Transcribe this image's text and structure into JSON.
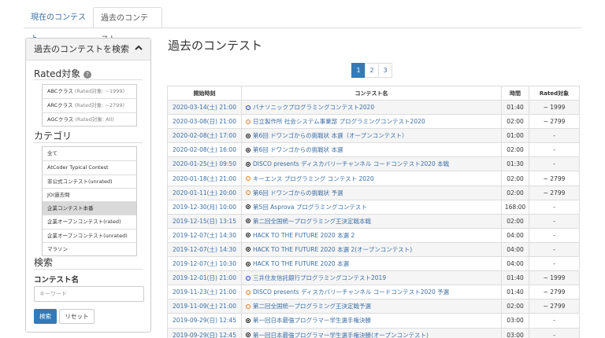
{
  "tabs": [
    "現在のコンテスト",
    "過去のコンテスト"
  ],
  "sidebar": {
    "header": "過去のコンテストを検索",
    "rated_title": "Rated対象",
    "rated_items": [
      {
        "label": "ABCクラス",
        "sub": "(Rated対象: ~1999)"
      },
      {
        "label": "ARCクラス",
        "sub": "(Rated対象: ~2799)"
      },
      {
        "label": "AGCクラス",
        "sub": "(Rated対象: All)"
      }
    ],
    "category_title": "カテゴリ",
    "category_items": [
      "全て",
      "AtCoder Typical Contest",
      "非公式コンテスト(unrated)",
      "JOI過去問",
      "企業コンテスト本番",
      "企業オープンコンテスト(rated)",
      "企業オープンコンテスト(unrated)",
      "マラソン"
    ],
    "category_selected": 4,
    "search_title": "検索",
    "contest_name_label": "コンテスト名",
    "keyword_placeholder": "キーワード",
    "search_button": "検索",
    "reset_button": "リセット"
  },
  "main": {
    "title": "過去のコンテスト",
    "pages": [
      "1",
      "2",
      "3"
    ],
    "active_page": 0,
    "columns": [
      "開始時刻",
      "コンテスト名",
      "時間",
      "Rated対象"
    ],
    "rows": [
      {
        "start": "2020-03-14(土) 21:00",
        "icon": "blue",
        "name": "パナソニックプログラミングコンテスト2020",
        "duration": "01:40",
        "rated": "~ 1999"
      },
      {
        "start": "2020-03-08(日) 21:00",
        "icon": "orange",
        "name": "日立製作所 社会システム事業部 プログラミングコンテスト2020",
        "duration": "02:00",
        "rated": "~ 2799"
      },
      {
        "start": "2020-02-08(土) 17:00",
        "icon": "black",
        "name": "第6回 ドワンゴからの挑戦状 本選（オープンコンテスト）",
        "duration": "01:00",
        "rated": "-"
      },
      {
        "start": "2020-02-08(土) 16:00",
        "icon": "black",
        "name": "第6回 ドワンゴからの挑戦状 本選",
        "duration": "02:00",
        "rated": "-"
      },
      {
        "start": "2020-01-25(土) 09:50",
        "icon": "black",
        "name": "DISCO presents ディスカバリーチャンネル コードコンテスト2020 本戦",
        "duration": "01:30",
        "rated": "-"
      },
      {
        "start": "2020-01-18(土) 21:00",
        "icon": "orange",
        "name": "キーエンス プログラミング コンテスト 2020",
        "duration": "02:00",
        "rated": "~ 2799"
      },
      {
        "start": "2020-01-11(土) 20:00",
        "icon": "orange",
        "name": "第6回 ドワンゴからの挑戦状 予選",
        "duration": "02:00",
        "rated": "~ 2799"
      },
      {
        "start": "2019-12-30(月) 10:00",
        "icon": "black",
        "name": "第5回 Asprova プログラミングコンテスト",
        "duration": "168:00",
        "rated": "-"
      },
      {
        "start": "2019-12-15(日) 13:15",
        "icon": "black",
        "name": "第二回全国統一プログラミング王決定戦本戦",
        "duration": "02:00",
        "rated": "-"
      },
      {
        "start": "2019-12-07(土) 14:30",
        "icon": "black",
        "name": "HACK TO THE FUTURE 2020 本選 2",
        "duration": "04:00",
        "rated": "-"
      },
      {
        "start": "2019-12-07(土) 14:30",
        "icon": "black",
        "name": "HACK TO THE FUTURE 2020 本選 2(オープンコンテスト)",
        "duration": "04:00",
        "rated": "-"
      },
      {
        "start": "2019-12-07(土) 10:30",
        "icon": "black",
        "name": "HACK TO THE FUTURE 2020 本選",
        "duration": "04:00",
        "rated": "-"
      },
      {
        "start": "2019-12-01(日) 21:00",
        "icon": "blue",
        "name": "三井住友信託銀行プログラミングコンテスト2019",
        "duration": "01:40",
        "rated": "~ 1999"
      },
      {
        "start": "2019-11-23(土) 21:00",
        "icon": "orange",
        "name": "DISCO presents ディスカバリーチャンネル コードコンテスト2020 予選",
        "duration": "01:40",
        "rated": "~ 2799"
      },
      {
        "start": "2019-11-09(土) 21:00",
        "icon": "orange",
        "name": "第二回全国統一プログラミング王決定戦予選",
        "duration": "02:00",
        "rated": "~ 2799"
      },
      {
        "start": "2019-09-29(日) 12:45",
        "icon": "black",
        "name": "第一回日本最強プログラマー学生選手権決勝",
        "duration": "03:00",
        "rated": "-"
      },
      {
        "start": "2019-09-29(日) 12:45",
        "icon": "black",
        "name": "第一回日本最強プログラマー学生選手権決勝(オープンコンテスト)",
        "duration": "03:00",
        "rated": "-"
      }
    ]
  }
}
